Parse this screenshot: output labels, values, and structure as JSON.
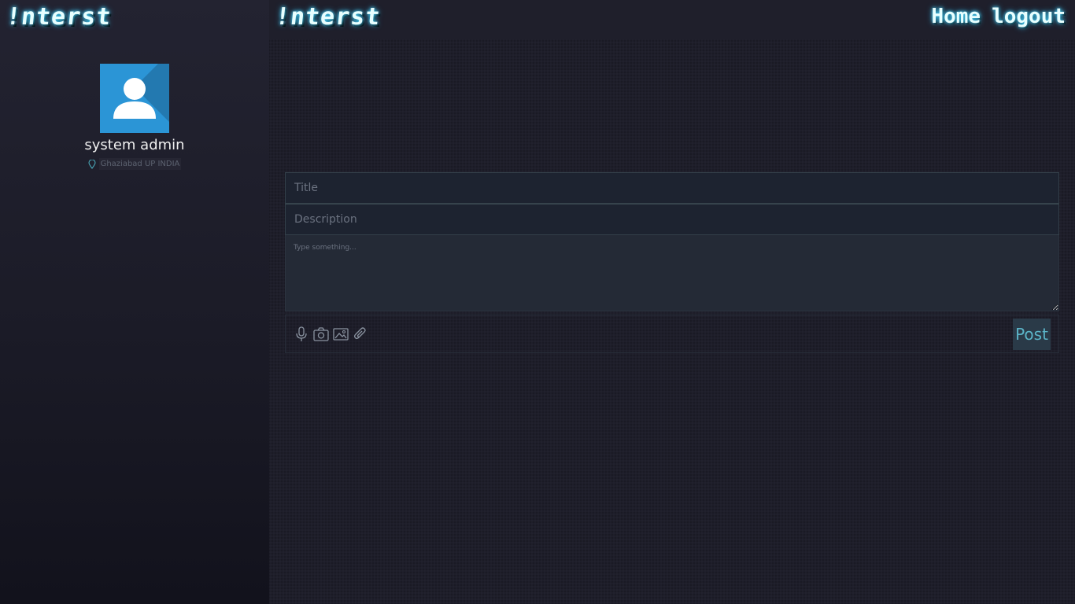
{
  "brand": {
    "logo_text": "!nterst"
  },
  "nav": {
    "home": "Home",
    "logout": "logout"
  },
  "profile": {
    "name": "system admin",
    "location": "Ghaziabad UP INDIA"
  },
  "composer": {
    "title_placeholder": "Title",
    "description_placeholder": "Description",
    "body_placeholder": "Type something...",
    "tools": [
      "microphone-icon",
      "camera-icon",
      "image-icon",
      "paperclip-icon"
    ],
    "post_label": "Post"
  },
  "colors": {
    "accent_glow": "#4fd8ff",
    "avatar_bg": "#2b95d6",
    "post_text": "#5bb4c8"
  }
}
